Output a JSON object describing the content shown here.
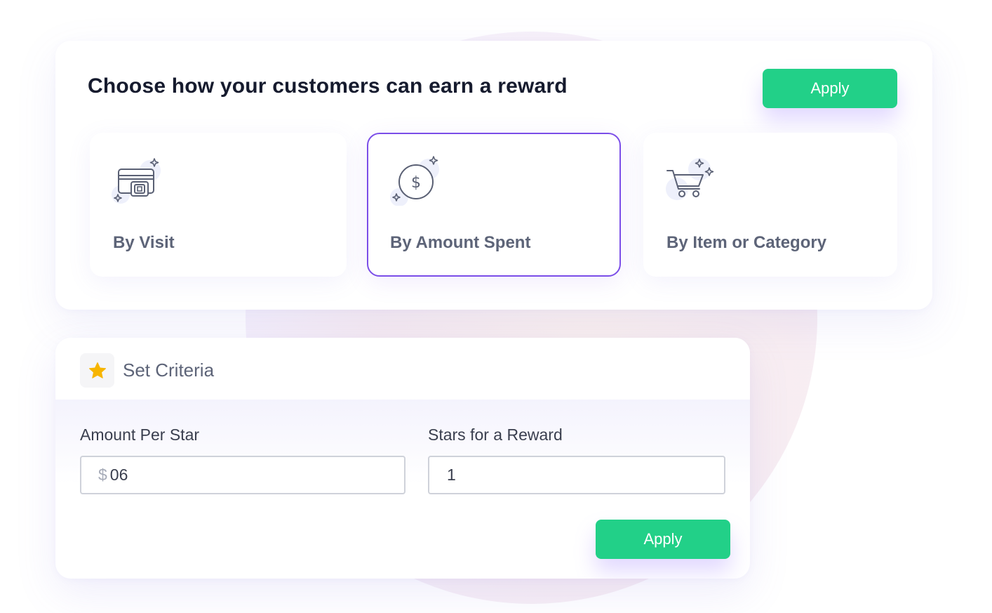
{
  "reward_method": {
    "title": "Choose how your customers can earn a reward",
    "apply_label": "Apply",
    "options": [
      {
        "label": "By Visit",
        "icon": "credit-card-icon",
        "selected": false
      },
      {
        "label": "By Amount Spent",
        "icon": "dollar-coin-icon",
        "selected": true
      },
      {
        "label": "By Item or Category",
        "icon": "shopping-cart-icon",
        "selected": false
      }
    ]
  },
  "criteria": {
    "title": "Set Criteria",
    "icon": "star-icon",
    "amount_per_star": {
      "label": "Amount Per Star",
      "currency": "$",
      "value": "06"
    },
    "stars_for_reward": {
      "label": "Stars for a Reward",
      "value": "1"
    },
    "apply_label": "Apply"
  },
  "colors": {
    "accent_green": "#22d088",
    "selected_border": "#7b4ee8",
    "star": "#f7b500",
    "title_text": "#161b2e",
    "muted_text": "#5d6478"
  }
}
